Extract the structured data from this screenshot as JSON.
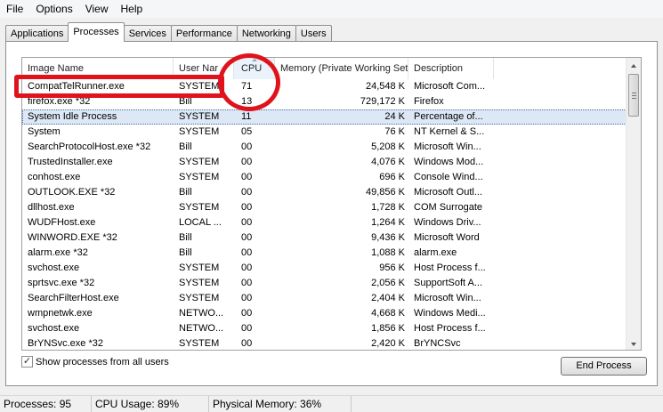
{
  "menu": [
    "File",
    "Options",
    "View",
    "Help"
  ],
  "tabs": [
    "Applications",
    "Processes",
    "Services",
    "Performance",
    "Networking",
    "Users"
  ],
  "columns": [
    "Image Name",
    "User Nar",
    "CPU",
    "Memory (Private Working Set)",
    "Description"
  ],
  "rows": [
    [
      "CompatTelRunner.exe",
      "SYSTEM",
      "71",
      "24,548 K",
      "Microsoft Com..."
    ],
    [
      "firefox.exe *32",
      "Bill",
      "13",
      "729,172 K",
      "Firefox"
    ],
    [
      "System Idle Process",
      "SYSTEM",
      "11",
      "24 K",
      "Percentage of..."
    ],
    [
      "System",
      "SYSTEM",
      "05",
      "76 K",
      "NT Kernel & S..."
    ],
    [
      "SearchProtocolHost.exe *32",
      "Bill",
      "00",
      "5,208 K",
      "Microsoft Win..."
    ],
    [
      "TrustedInstaller.exe",
      "SYSTEM",
      "00",
      "4,076 K",
      "Windows Mod..."
    ],
    [
      "conhost.exe",
      "SYSTEM",
      "00",
      "696 K",
      "Console Wind..."
    ],
    [
      "OUTLOOK.EXE *32",
      "Bill",
      "00",
      "49,856 K",
      "Microsoft Outl..."
    ],
    [
      "dllhost.exe",
      "SYSTEM",
      "00",
      "1,728 K",
      "COM Surrogate"
    ],
    [
      "WUDFHost.exe",
      "LOCAL ...",
      "00",
      "1,264 K",
      "Windows Driv..."
    ],
    [
      "WINWORD.EXE *32",
      "Bill",
      "00",
      "9,436 K",
      "Microsoft Word"
    ],
    [
      "alarm.exe *32",
      "Bill",
      "00",
      "1,088 K",
      "alarm.exe"
    ],
    [
      "svchost.exe",
      "SYSTEM",
      "00",
      "956 K",
      "Host Process f..."
    ],
    [
      "sprtsvc.exe *32",
      "SYSTEM",
      "00",
      "2,056 K",
      "SupportSoft A..."
    ],
    [
      "SearchFilterHost.exe",
      "SYSTEM",
      "00",
      "2,404 K",
      "Microsoft Win..."
    ],
    [
      "wmpnetwk.exe",
      "NETWO...",
      "00",
      "4,668 K",
      "Windows Medi..."
    ],
    [
      "svchost.exe",
      "NETWO...",
      "00",
      "1,856 K",
      "Host Process f..."
    ],
    [
      "BrYNSvc.exe *32",
      "SYSTEM",
      "00",
      "2,420 K",
      "BrYNCSvc"
    ]
  ],
  "show_all_label": "Show processes from all users",
  "show_all_checked": "✓",
  "end_process_label": "End Process",
  "status": {
    "processes": "Processes: 95",
    "cpu": "CPU Usage: 89%",
    "memory": "Physical Memory: 36%"
  },
  "annotation_color": "#e0131d"
}
